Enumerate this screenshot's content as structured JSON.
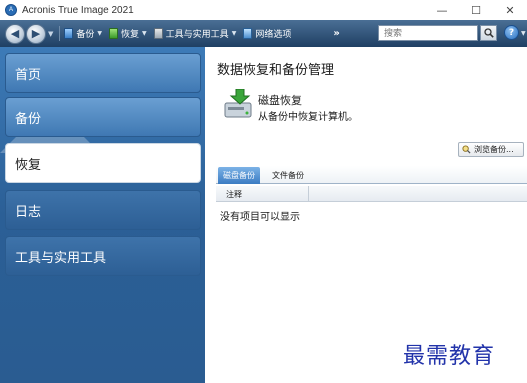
{
  "window": {
    "title": "Acronis True Image 2021"
  },
  "toolbar": {
    "backup": "备份",
    "recover": "恢复",
    "tools": "工具与实用工具",
    "network": "网络选项",
    "more": "»",
    "search_placeholder": "搜索",
    "help": "?"
  },
  "sidebar": {
    "items": [
      {
        "label": "首页"
      },
      {
        "label": "备份"
      },
      {
        "label": "恢复"
      },
      {
        "label": "日志"
      },
      {
        "label": "工具与实用工具"
      }
    ]
  },
  "main": {
    "title": "数据恢复和备份管理",
    "task": {
      "title": "磁盘恢复",
      "desc": "从备份中恢复计算机。"
    },
    "browse_label": "浏览备份...",
    "tabs": [
      {
        "label": "磁盘备份"
      },
      {
        "label": "文件备份"
      }
    ],
    "columns": [
      "注释"
    ],
    "empty_message": "没有项目可以显示"
  },
  "watermark": "最需教育",
  "colors": {
    "toolbar": "#2d5177",
    "sidebar": "#2f68a2",
    "accent_tab": "#3a7bc2",
    "watermark": "#2233aa"
  }
}
